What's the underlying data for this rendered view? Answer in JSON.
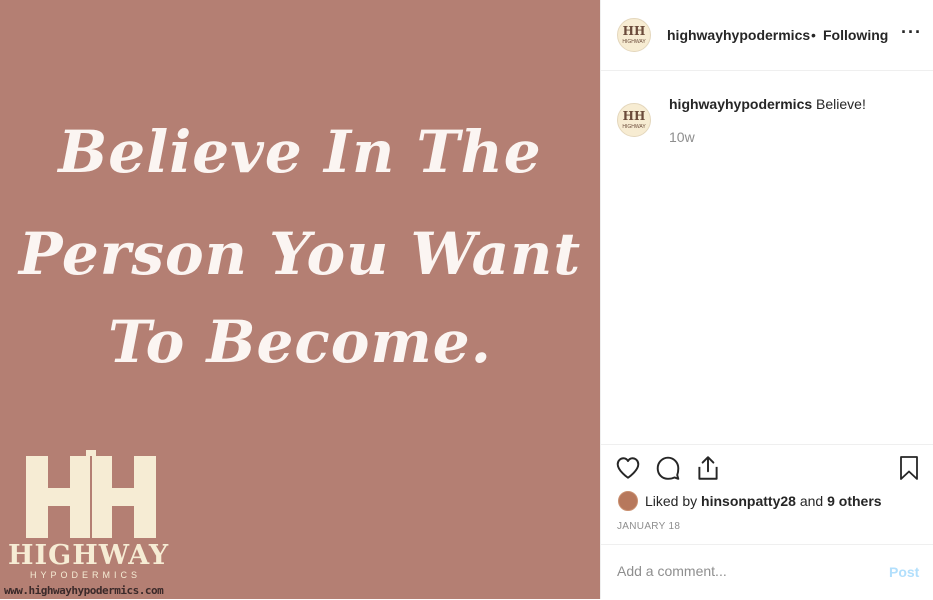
{
  "image": {
    "quote_lines": [
      "Believe In The",
      "Person You Want",
      "To Become."
    ],
    "logo": {
      "initials": "HH",
      "name": "HIGHWAY",
      "subtitle": "HYPODERMICS",
      "url": "www.highwayhypodermics.com"
    },
    "background_color": "#b47f73"
  },
  "header": {
    "avatar_initials": "HH",
    "avatar_small": "HIGHWAY",
    "username": "highwayhypodermics",
    "separator": "•",
    "follow_status": "Following",
    "more_icon": "more-options-icon",
    "more_label": "···"
  },
  "caption": {
    "username": "highwayhypodermics",
    "text": "Believe!",
    "time": "10w"
  },
  "actions": {
    "icons": [
      "heart-icon",
      "comment-icon",
      "share-icon",
      "bookmark-icon"
    ]
  },
  "likes": {
    "prefix": "Liked by",
    "user": "hinsonpatty28",
    "and": "and",
    "others": "9 others"
  },
  "date": "JANUARY 18",
  "comment": {
    "placeholder": "Add a comment...",
    "post_label": "Post"
  }
}
